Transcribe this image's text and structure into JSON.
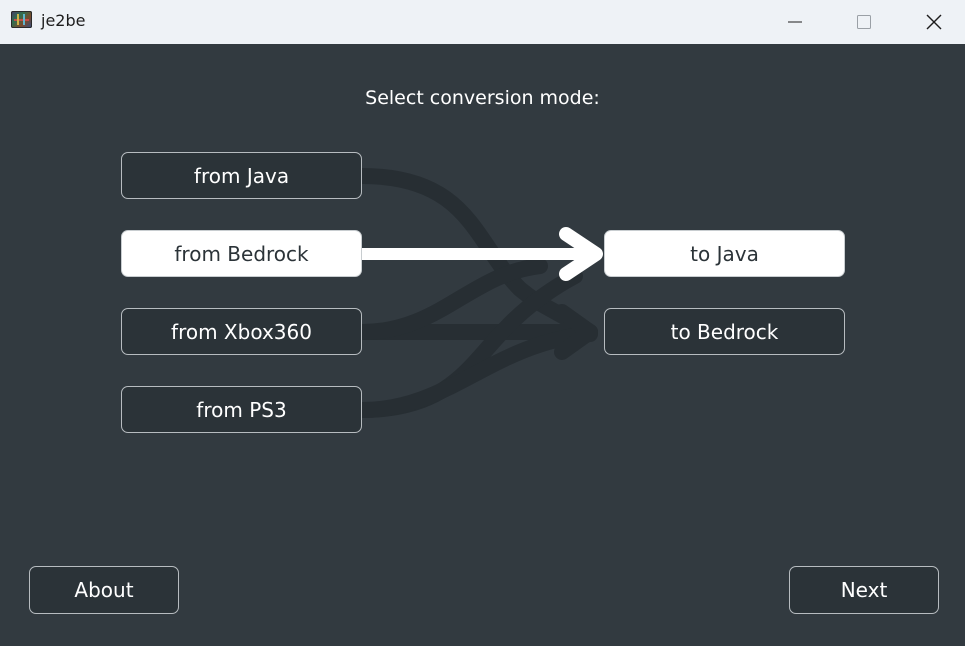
{
  "window": {
    "title": "je2be",
    "app_icon": "je2be-app-icon",
    "controls": [
      "minimize-icon",
      "maximize-icon",
      "close-icon"
    ]
  },
  "main": {
    "heading": "Select conversion mode:",
    "sources": [
      {
        "label": "from Java",
        "selected": false
      },
      {
        "label": "from Bedrock",
        "selected": true
      },
      {
        "label": "from Xbox360",
        "selected": false
      },
      {
        "label": "from PS3",
        "selected": false
      }
    ],
    "targets": [
      {
        "label": "to Java",
        "selected": true
      },
      {
        "label": "to Bedrock",
        "selected": false
      }
    ]
  },
  "footer": {
    "about_label": "About",
    "next_label": "Next"
  },
  "colors": {
    "background": "#323a40",
    "button_bg": "#2b3338",
    "button_border": "#b7bcc0",
    "selected_bg": "#ffffff",
    "flow_inactive": "#272e33",
    "flow_active": "#ffffff",
    "titlebar": "#eef2f6"
  }
}
